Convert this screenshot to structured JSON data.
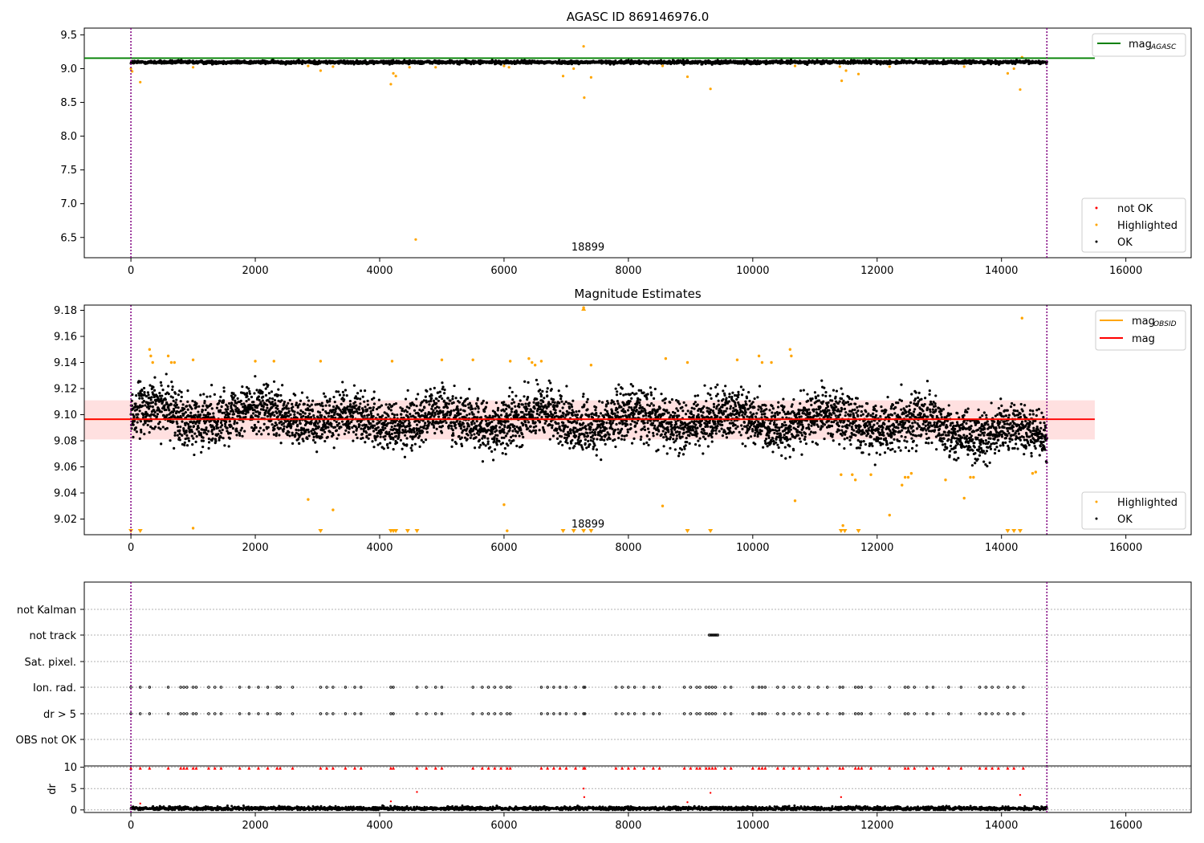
{
  "chart_data": [
    {
      "type": "scatter",
      "title": "AGASC ID 869146976.0",
      "xlim": [
        -750,
        17050
      ],
      "ylim": [
        6.2,
        9.6
      ],
      "xticks": [
        0,
        2000,
        4000,
        6000,
        8000,
        10000,
        12000,
        14000,
        16000
      ],
      "yticks": [
        6.5,
        7.0,
        7.5,
        8.0,
        8.5,
        9.0,
        9.5
      ],
      "hline": {
        "name": "mag",
        "subscript": "AGASC",
        "y": 9.155,
        "x_end": 15500,
        "color": "#008000"
      },
      "vlines": [
        0,
        14730
      ],
      "annotation": {
        "text": "18899",
        "x": 7350,
        "y": 6.3
      },
      "ok_band": {
        "center": 9.095,
        "spread": 0.02,
        "x_start": 0,
        "x_end": 14730
      },
      "legend": {
        "placement": "lower right",
        "entries": [
          {
            "label": "not OK",
            "color": "#ff0000"
          },
          {
            "label": "Highlighted",
            "color": "#ffa500"
          },
          {
            "label": "OK",
            "color": "#000000"
          }
        ]
      },
      "highlighted_points": [
        [
          0,
          9.0
        ],
        [
          20,
          8.96
        ],
        [
          150,
          8.8
        ],
        [
          1000,
          9.02
        ],
        [
          2850,
          9.04
        ],
        [
          3050,
          8.97
        ],
        [
          3250,
          9.03
        ],
        [
          4180,
          8.77
        ],
        [
          4220,
          8.93
        ],
        [
          4260,
          8.89
        ],
        [
          4480,
          9.02
        ],
        [
          4580,
          6.47
        ],
        [
          4900,
          9.02
        ],
        [
          6000,
          9.04
        ],
        [
          6080,
          9.02
        ],
        [
          6950,
          8.89
        ],
        [
          7120,
          9.0
        ],
        [
          7280,
          9.33
        ],
        [
          7290,
          8.57
        ],
        [
          7400,
          8.87
        ],
        [
          8550,
          9.04
        ],
        [
          8950,
          8.88
        ],
        [
          9320,
          8.7
        ],
        [
          10680,
          9.04
        ],
        [
          11400,
          9.03
        ],
        [
          11430,
          8.82
        ],
        [
          11500,
          8.97
        ],
        [
          11700,
          8.92
        ],
        [
          12200,
          9.03
        ],
        [
          13400,
          9.03
        ],
        [
          14100,
          8.93
        ],
        [
          14200,
          9.0
        ],
        [
          14300,
          8.69
        ],
        [
          14330,
          9.17
        ]
      ]
    },
    {
      "type": "scatter",
      "title": "Magnitude Estimates",
      "xlim": [
        -750,
        17050
      ],
      "ylim": [
        9.008,
        9.184
      ],
      "xticks": [
        0,
        2000,
        4000,
        6000,
        8000,
        10000,
        12000,
        14000,
        16000
      ],
      "yticks": [
        9.02,
        9.04,
        9.06,
        9.08,
        9.1,
        9.12,
        9.14,
        9.16,
        9.18
      ],
      "hlines": [
        {
          "name": "mag",
          "subscript": "OBSID",
          "y": 9.0965,
          "x_end": 14730,
          "color": "#ffa500"
        },
        {
          "name": "mag",
          "subscript": "",
          "y": 9.0965,
          "x_end": 15500,
          "color": "#ff0000"
        }
      ],
      "band": {
        "y_low": 9.081,
        "y_high": 9.111,
        "x_end": 15500
      },
      "vlines": [
        0,
        14730
      ],
      "annotation": {
        "text": "18899",
        "x": 7350,
        "y": 9.014
      },
      "ok_band": {
        "center": 9.096,
        "spread": 0.016,
        "x_start": 0,
        "x_end": 14730
      },
      "legend_top": {
        "placement": "upper right",
        "entries": [
          {
            "label": "mag",
            "subscript": "OBSID",
            "color": "#ffa500"
          },
          {
            "label": "mag",
            "subscript": "",
            "color": "#ff0000"
          }
        ]
      },
      "legend_bottom": {
        "placement": "lower right",
        "entries": [
          {
            "label": "Highlighted",
            "color": "#ffa500"
          },
          {
            "label": "OK",
            "color": "#000000"
          }
        ]
      },
      "highlighted_points": [
        [
          300,
          9.15
        ],
        [
          320,
          9.145
        ],
        [
          350,
          9.14
        ],
        [
          600,
          9.145
        ],
        [
          650,
          9.14
        ],
        [
          700,
          9.14
        ],
        [
          1000,
          9.142
        ],
        [
          2000,
          9.141
        ],
        [
          2300,
          9.141
        ],
        [
          2850,
          9.035
        ],
        [
          3050,
          9.141
        ],
        [
          3250,
          9.027
        ],
        [
          4200,
          9.141
        ],
        [
          5000,
          9.142
        ],
        [
          5500,
          9.142
        ],
        [
          6000,
          9.031
        ],
        [
          6050,
          9.011
        ],
        [
          6100,
          9.141
        ],
        [
          6400,
          9.143
        ],
        [
          6450,
          9.14
        ],
        [
          6500,
          9.138
        ],
        [
          6600,
          9.141
        ],
        [
          7280,
          9.182
        ],
        [
          7400,
          9.138
        ],
        [
          8550,
          9.03
        ],
        [
          8600,
          9.143
        ],
        [
          8950,
          9.14
        ],
        [
          9750,
          9.142
        ],
        [
          10100,
          9.145
        ],
        [
          10150,
          9.14
        ],
        [
          10300,
          9.14
        ],
        [
          10600,
          9.15
        ],
        [
          10620,
          9.145
        ],
        [
          10680,
          9.034
        ],
        [
          11420,
          9.054
        ],
        [
          11450,
          9.015
        ],
        [
          11600,
          9.054
        ],
        [
          11650,
          9.05
        ],
        [
          11900,
          9.054
        ],
        [
          12200,
          9.023
        ],
        [
          12400,
          9.046
        ],
        [
          12450,
          9.052
        ],
        [
          12500,
          9.052
        ],
        [
          12550,
          9.055
        ],
        [
          13100,
          9.05
        ],
        [
          13400,
          9.036
        ],
        [
          13500,
          9.052
        ],
        [
          13550,
          9.052
        ],
        [
          14330,
          9.174
        ],
        [
          14500,
          9.055
        ],
        [
          14550,
          9.056
        ],
        [
          1000,
          9.013
        ]
      ],
      "below_range_markers": [
        0,
        150,
        3050,
        4180,
        4220,
        4260,
        4450,
        4600,
        6950,
        7120,
        7280,
        7400,
        8950,
        9320,
        11420,
        11480,
        11700,
        14100,
        14200,
        14300
      ]
    },
    {
      "type": "scatter",
      "xlim": [
        -750,
        17050
      ],
      "xticks": [
        0,
        2000,
        4000,
        6000,
        8000,
        10000,
        12000,
        14000,
        16000
      ],
      "flag_labels": [
        "not Kalman",
        "not track",
        "Sat. pixel.",
        "Ion. rad.",
        "dr > 5",
        "OBS not OK"
      ],
      "vlines": [
        0,
        14730
      ],
      "not_track_x": [
        9300,
        9440
      ],
      "event_x": [
        0,
        150,
        300,
        600,
        800,
        850,
        900,
        1000,
        1050,
        1250,
        1350,
        1450,
        1750,
        1900,
        2050,
        2200,
        2350,
        2400,
        2600,
        3050,
        3150,
        3250,
        3450,
        3600,
        3700,
        4180,
        4220,
        4600,
        4750,
        4900,
        5000,
        5500,
        5650,
        5750,
        5850,
        5950,
        6050,
        6100,
        6600,
        6700,
        6800,
        6900,
        7000,
        7150,
        7280,
        7300,
        7800,
        7900,
        8000,
        8100,
        8250,
        8400,
        8500,
        8900,
        9000,
        9100,
        9150,
        9250,
        9300,
        9350,
        9400,
        9550,
        9650,
        10000,
        10100,
        10150,
        10200,
        10400,
        10500,
        10650,
        10750,
        10900,
        11050,
        11200,
        11400,
        11450,
        11650,
        11700,
        11750,
        11900,
        12200,
        12450,
        12500,
        12600,
        12800,
        12900,
        13150,
        13350,
        13650,
        13750,
        13850,
        13950,
        14100,
        14200,
        14350
      ],
      "dr": {
        "ylabel": "dr",
        "ylim": [
          -0.6,
          10.3
        ],
        "yticks": [
          0,
          5,
          10
        ],
        "baseline_mean": 0.35,
        "high_points": [
          [
            4600,
            4.2
          ],
          [
            7280,
            5.0
          ],
          [
            7290,
            3.0
          ],
          [
            8950,
            1.8
          ],
          [
            9320,
            4.0
          ],
          [
            11420,
            3.0
          ],
          [
            14300,
            3.5
          ],
          [
            4180,
            2.0
          ],
          [
            150,
            1.5
          ]
        ]
      }
    }
  ]
}
